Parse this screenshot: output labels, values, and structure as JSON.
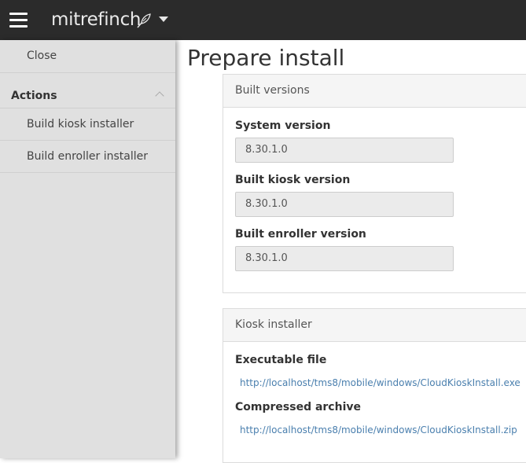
{
  "topbar": {
    "brand": "mitrefinch",
    "menu_icon": "hamburger-menu-icon",
    "brand_icon": "feather-icon",
    "caret_icon": "caret-down-icon"
  },
  "sidebar": {
    "close_label": "Close",
    "section_title": "Actions",
    "section_icon": "chevron-up-icon",
    "items": [
      {
        "label": "Build kiosk installer"
      },
      {
        "label": "Build enroller installer"
      }
    ]
  },
  "main": {
    "title": "Prepare install",
    "built_versions": {
      "heading": "Built versions",
      "fields": [
        {
          "label": "System version",
          "value": "8.30.1.0"
        },
        {
          "label": "Built kiosk version",
          "value": "8.30.1.0"
        },
        {
          "label": "Built enroller version",
          "value": "8.30.1.0"
        }
      ]
    },
    "kiosk_installer": {
      "heading": "Kiosk installer",
      "executable_label": "Executable file",
      "executable_link": "http://localhost/tms8/mobile/windows/CloudKioskInstall.exe",
      "archive_label": "Compressed archive",
      "archive_link": "http://localhost/tms8/mobile/windows/CloudKioskInstall.zip"
    }
  },
  "colors": {
    "topbar": "#2b2b2b",
    "sidebar": "#e0e0e0",
    "link": "#4a7fae"
  }
}
